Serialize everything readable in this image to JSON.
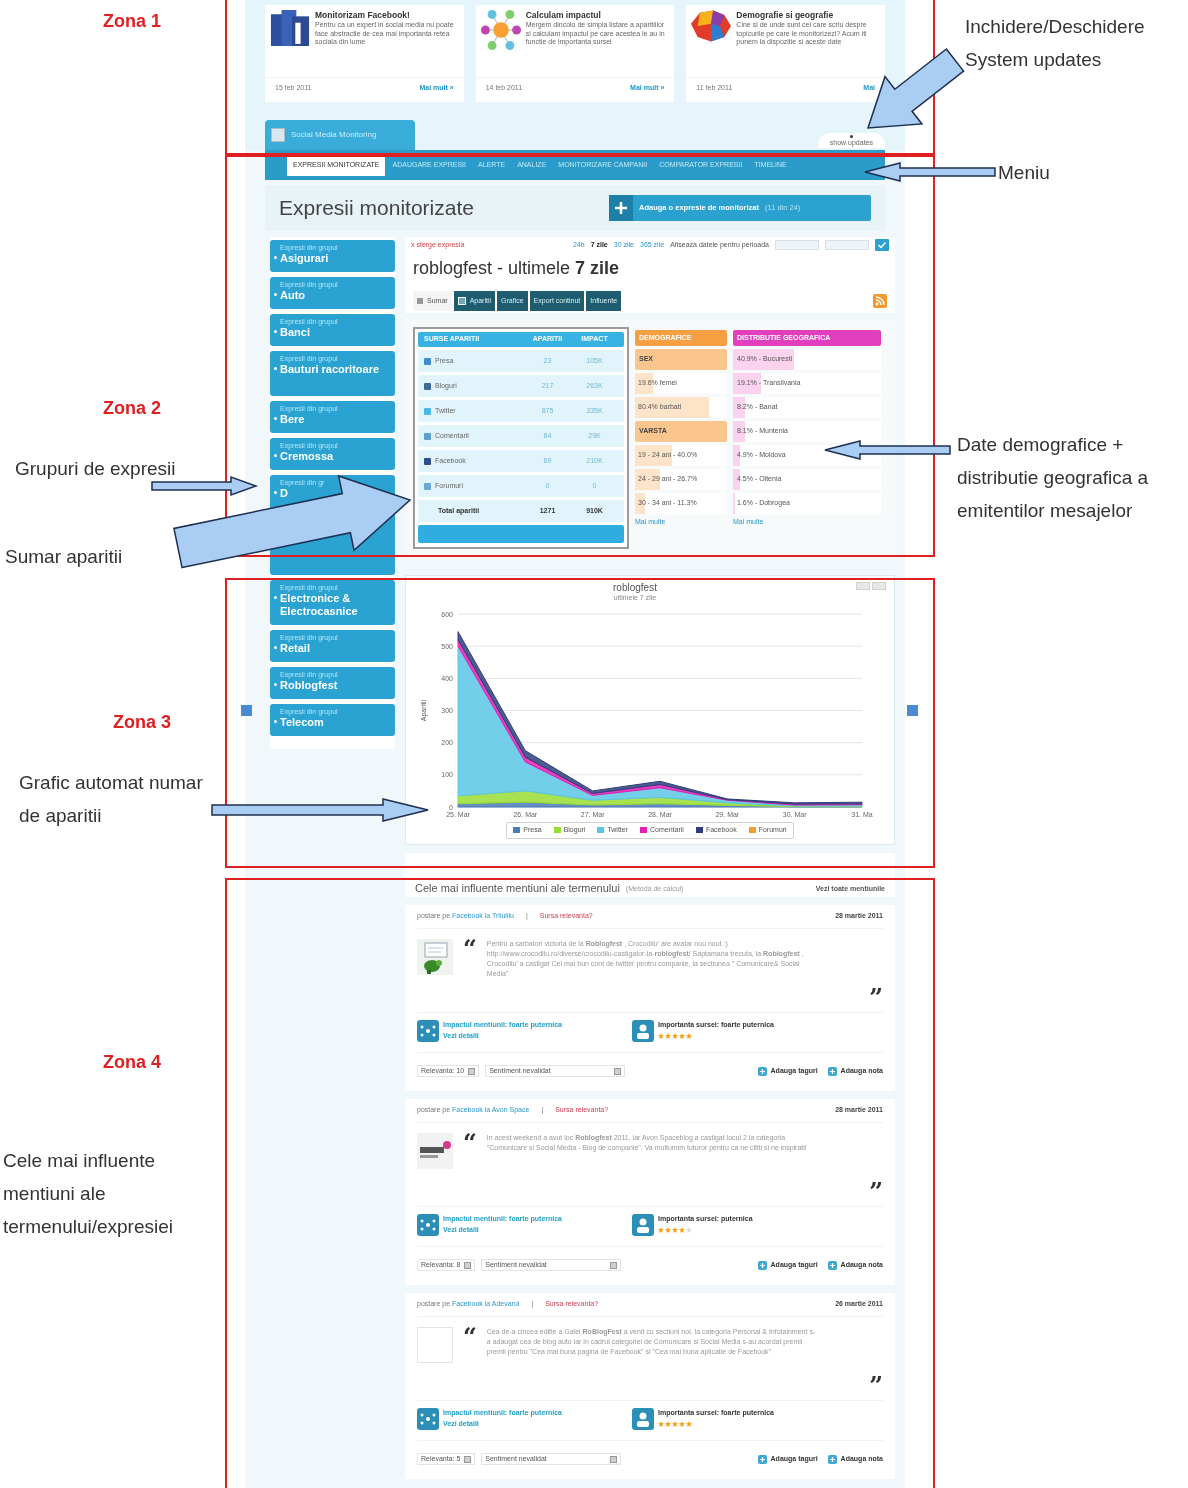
{
  "annotations": {
    "zones": [
      {
        "label": "Zona 1"
      },
      {
        "label": "Zona 2"
      },
      {
        "label": "Zona 3"
      },
      {
        "label": "Zona 4"
      }
    ],
    "callouts": [
      {
        "text": "Inchidere/Deschidere System updates"
      },
      {
        "text": "Meniu"
      },
      {
        "text": "Grupuri de expresii"
      },
      {
        "text": "Sumar aparitii"
      },
      {
        "text": "Date demografice + distributie geografica a emitentilor mesajelor"
      },
      {
        "text": "Grafic automat numar de aparitii"
      },
      {
        "text": "Cele mai influente mentiuni ale termenului/expresiei"
      }
    ]
  },
  "news": [
    {
      "kind": "cubes",
      "title": "Monitorizam Facebook!",
      "text": "Pentru ca un expert in social media nu poate face abstractie de cea mai importanta retea sociala din lume",
      "date": "15 feb 2011",
      "link": "Mai mult »"
    },
    {
      "kind": "network",
      "title": "Calculam impactul",
      "text": "Mergem dincolo de simpla listare a aparitiilor si calculam impactul pe care acestea le au in functie de importanta sursei",
      "date": "14 feb 2011",
      "link": "Mai mult »"
    },
    {
      "kind": "map",
      "title": "Demografie si geografie",
      "text": "Cine si de unde sunt cei care scriu despre topicurile pe care le monitorizezi? Acum iti punem la dispozitie si aceste date",
      "date": "11 feb 2011",
      "link": "Mai"
    }
  ],
  "brand": "Social Media Monitoring",
  "updates_toggle": "show updates",
  "menu": [
    {
      "label": "EXPRESII MONITORIZATE",
      "selected": true
    },
    {
      "label": "ADAUGARE EXPRESII",
      "selected": false
    },
    {
      "label": "ALERTE",
      "selected": false
    },
    {
      "label": "ANALIZE",
      "selected": false
    },
    {
      "label": "MONITORIZARE CAMPANII",
      "selected": false
    },
    {
      "label": "COMPARATOR EXPRESII",
      "selected": false
    },
    {
      "label": "TIMELINE",
      "selected": false
    }
  ],
  "page_title": "Expresii monitorizate",
  "add_button": {
    "label": "Adauga o expresie de monitorizat",
    "note": "(11 din 24)"
  },
  "groups": [
    {
      "caption": "Expresii din grupul",
      "name": "Asigurari"
    },
    {
      "caption": "Expresii din grupul",
      "name": "Auto"
    },
    {
      "caption": "Expresii din grupul",
      "name": "Banci"
    },
    {
      "caption": "Expresii din grupul",
      "name": "Bauturi racoritoare"
    },
    {
      "caption": "Expresii din grupul",
      "name": "Bere"
    },
    {
      "caption": "Expresii din grupul",
      "name": "Cremossa"
    },
    {
      "caption": "Expresii din gr",
      "name": "D"
    },
    {
      "caption": "Expresii din grupul",
      "name": "Electronice & Electrocasnice"
    },
    {
      "caption": "Expresii din grupul",
      "name": "Retail"
    },
    {
      "caption": "Expresii din grupul",
      "name": "Roblogfest"
    },
    {
      "caption": "Expresii din grupul",
      "name": "Telecom"
    }
  ],
  "delete_link": "x sterge expresia",
  "periods": [
    {
      "label": "24h",
      "selected": false
    },
    {
      "label": "7 zile",
      "selected": true
    },
    {
      "label": "30 zile",
      "selected": false
    },
    {
      "label": "365 zile",
      "selected": false
    }
  ],
  "period_label": "Afiseaza datele pentru perioada",
  "heading": "roblogfest - ultimele **7 zile**",
  "tabs": [
    {
      "label": "Sumar",
      "selected": true,
      "icon": true
    },
    {
      "label": "Aparitii",
      "selected": false,
      "icon": true
    },
    {
      "label": "Grafice",
      "selected": false,
      "icon": false
    },
    {
      "label": "Export continut",
      "selected": false,
      "icon": false
    },
    {
      "label": "Influente",
      "selected": false,
      "icon": false
    }
  ],
  "sources": {
    "columns": [
      "SURSE APARITII",
      "APARITII",
      "IMPACT"
    ],
    "rows": [
      {
        "kind": "source",
        "color": "#3b8fd0",
        "cells": [
          "Presa",
          "23",
          "105K"
        ]
      },
      {
        "kind": "source",
        "color": "#3a6a9a",
        "cells": [
          "Bloguri",
          "217",
          "263K"
        ]
      },
      {
        "kind": "source",
        "color": "#4ab8e8",
        "cells": [
          "Twitter",
          "875",
          "335K"
        ]
      },
      {
        "kind": "source",
        "color": "#5aa0c8",
        "cells": [
          "Comentarii",
          "84",
          "29K"
        ]
      },
      {
        "kind": "source",
        "color": "#2e4f8e",
        "cells": [
          "Facebook",
          "69",
          "210K"
        ]
      },
      {
        "kind": "source",
        "color": "#6aa8d8",
        "cells": [
          "Forumuri",
          "0",
          "0"
        ]
      },
      {
        "kind": "total",
        "cells": [
          "Total aparitii",
          "1271",
          "910K"
        ]
      }
    ]
  },
  "demographics": {
    "title": "DEMOGRAFICE",
    "rows": [
      {
        "kind": "heading",
        "text": "SEX"
      },
      {
        "kind": "bar",
        "text": "19.6% femei",
        "level": 0.196
      },
      {
        "kind": "bar",
        "text": "80.4% barbati",
        "level": 0.804
      },
      {
        "kind": "heading",
        "text": "VARSTA"
      },
      {
        "kind": "bar",
        "text": "19 - 24 ani - 40.0%",
        "level": 0.4
      },
      {
        "kind": "bar",
        "text": "24 - 29 ani - 26.7%",
        "level": 0.267
      },
      {
        "kind": "bar",
        "text": "30 - 34 ani - 11.3%",
        "level": 0.113
      }
    ],
    "more": "Mai multe"
  },
  "geography": {
    "title": "DISTRIBUTIE GEOGRAFICA",
    "rows": [
      {
        "text": "40.9% - Bucuresti",
        "level": 0.409
      },
      {
        "text": "19.1% - Transilvania",
        "level": 0.191
      },
      {
        "text": "8.2% - Banat",
        "level": 0.082
      },
      {
        "text": "8.1% - Muntenia",
        "level": 0.081
      },
      {
        "text": "4.9% - Moldova",
        "level": 0.049
      },
      {
        "text": "4.5% - Oltenia",
        "level": 0.045
      },
      {
        "text": "1.6% - Dobrogea",
        "level": 0.016
      }
    ],
    "more": "Mai multe"
  },
  "chart_panel": {
    "subtitle": "ultimele 7 zile",
    "chart_data": {
      "type": "area",
      "title": "roblogfest",
      "ylabel": "Aparitii",
      "stacked": true,
      "grid": true,
      "legend": true,
      "categories": [
        "25. Mar",
        "26. Mar",
        "27. Mar",
        "28. Mar",
        "29. Mar",
        "30. Mar",
        "31. Ma"
      ],
      "ylim": [
        0,
        600
      ],
      "yticks": [
        0,
        100,
        200,
        300,
        400,
        500,
        600
      ],
      "series": [
        {
          "name": "Presa",
          "color": "#4a7ab8",
          "values": [
            10,
            15,
            6,
            10,
            5,
            1,
            1
          ]
        },
        {
          "name": "Bloguri",
          "color": "#99dd33",
          "values": [
            25,
            35,
            15,
            20,
            8,
            2,
            2
          ]
        },
        {
          "name": "Twitter",
          "color": "#5bc5e6",
          "values": [
            465,
            90,
            15,
            30,
            8,
            3,
            4
          ]
        },
        {
          "name": "Comentarii",
          "color": "#e61eb4",
          "values": [
            20,
            15,
            6,
            10,
            2,
            3,
            3
          ]
        },
        {
          "name": "Facebook",
          "color": "#2e3f7c",
          "values": [
            25,
            20,
            8,
            10,
            2,
            4,
            5
          ]
        },
        {
          "name": "Forumuri",
          "color": "#f0a030",
          "values": [
            null,
            null,
            null,
            null,
            null,
            null,
            null
          ]
        }
      ]
    }
  },
  "influence": {
    "title": "Cele mai influente mentiuni ale termenului",
    "method": "(Metoda de calcul)",
    "all": "Vezi toate mentiunile"
  },
  "mentions": [
    {
      "prefix": "postare pe",
      "source": "Facebook la Trilulilu",
      "separator": "|",
      "relevance_q": "Sursa relevanta?",
      "date": "28 martie 2011",
      "avatar": {
        "kind": "picture"
      },
      "open_mark": "“",
      "close_mark": "”",
      "quote": "Pentru a sarbatori victoria de la **Roblogfest** , Crocodilu' are avatar nou nout :) http://www.crocodilu.ro/diverse/crocodilu-castigator-la-**roblogfest**/ Saptamana trecuta, la **Roblogfest** , Crocodilu' a castigat Cel mai bun cont de twitter pentru companie, la sectiunea \" Comunicare& Social Media\"",
      "impact": "Impactul mentiunii: foarte puternica",
      "details": "Vezi detalii",
      "importance": "Importanta sursei: foarte puternica",
      "stars": 5,
      "relevance": "Relevanta: 10",
      "sentiment": "Sentiment nevalidat",
      "actions": [
        "Adauga taguri",
        "Adauga nota"
      ]
    },
    {
      "prefix": "postare pe",
      "source": "Facebook la Avon Space",
      "separator": "|",
      "relevance_q": "Sursa relevanta?",
      "date": "28 martie 2011",
      "avatar": {
        "kind": "logo"
      },
      "open_mark": "“",
      "close_mark": "”",
      "quote": "In acest weekend a avut loc **Roblogfest** 2011, iar Avon Spaceblog a castigat locul 2 la categoria \"Comunicare si Social Media - Blog de companie\". Va multumim tuturor pentru ca ne cititi si ne inspirati!",
      "impact": "Impactul mentiunii: foarte puternica",
      "details": "Vezi detalii",
      "importance": "Importanta sursei: puternica",
      "stars": 4,
      "relevance": "Relevanta: 8",
      "sentiment": "Sentiment nevalidat",
      "actions": [
        "Adauga taguri",
        "Adauga nota"
      ]
    },
    {
      "prefix": "postare pe",
      "source": "Facebook la Adevarul",
      "separator": "|",
      "relevance_q": "Sursa relevanta?",
      "date": "26 martie 2011",
      "avatar": {
        "kind": "blank"
      },
      "open_mark": "“",
      "close_mark": "”",
      "quote": "Cea de-a cincea editie a Galei **RoBlogFest** a venit cu sectiuni noi. la categoria Personal & Infotainment s-a adaugat cea de blog auto iar in cadrul categoriei de Comunicare si Social Media s-au acordat premii premii pentru \"Cea mai buna pagina de Facebook\" si \"Cea mai buna aplicatie de Facebook\"",
      "impact": "Impactul mentiunii: foarte puternica",
      "details": "Vezi detalii",
      "importance": "Importanta sursei: foarte puternica",
      "stars": 5,
      "relevance": "Relevanta: 5",
      "sentiment": "Sentiment nevalidat",
      "actions": [
        "Adauga taguri",
        "Adauga nota"
      ]
    }
  ]
}
